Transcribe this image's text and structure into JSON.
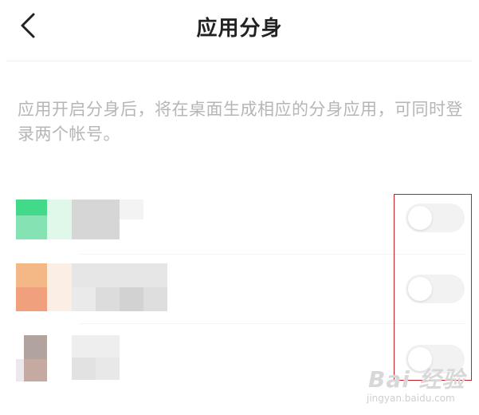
{
  "header": {
    "title": "应用分身",
    "back_icon": "chevron-left-icon"
  },
  "description": "应用开启分身后，将在桌面生成相应的分身应用，可同时登录两个帐号。",
  "apps": [
    {
      "icon_colors": [
        "#43d98a",
        "#85e2b3",
        "#dff8ea"
      ],
      "clone_enabled": false
    },
    {
      "icon_colors": [
        "#f4b886",
        "#f0a07c",
        "#fbeee4"
      ],
      "clone_enabled": false
    },
    {
      "icon_colors": [
        "#b1a39e",
        "#c5aaa2",
        "#ece9ee"
      ],
      "clone_enabled": false
    }
  ],
  "colors": {
    "highlight_border": "#c81e28",
    "toggle_off": "#f2f2f2",
    "description_text": "#b6b6b6"
  },
  "watermark": {
    "logo": "Bai 经验",
    "url": "jingyan.baidu.com"
  }
}
